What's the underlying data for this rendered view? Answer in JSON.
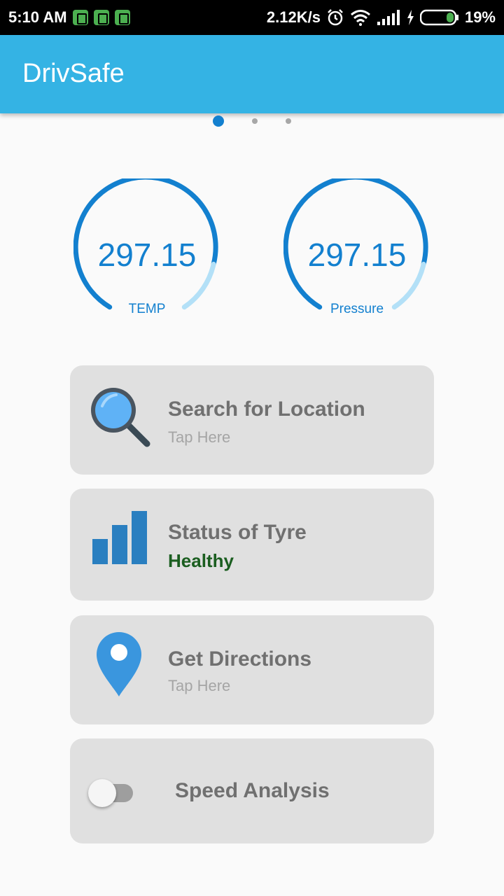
{
  "status_bar": {
    "time": "5:10 AM",
    "network_speed": "2.12K/s",
    "battery": "19%",
    "icons": [
      "notification-icon",
      "alarm-icon",
      "wifi-icon",
      "signal-icon",
      "charging-icon",
      "battery-icon"
    ]
  },
  "app_bar": {
    "title": "DrivSafe"
  },
  "pager": {
    "pages": 3,
    "active": 0
  },
  "gauges": [
    {
      "value": "297.15",
      "label": "TEMP",
      "accent": "#1380cf",
      "track": "#b3e0f7"
    },
    {
      "value": "297.15",
      "label": "Pressure",
      "accent": "#1380cf",
      "track": "#b3e0f7"
    }
  ],
  "cards": {
    "search": {
      "title": "Search for Location",
      "subtitle": "Tap Here",
      "icon": "magnifier-icon"
    },
    "tyre": {
      "title": "Status of Tyre",
      "status": "Healthy",
      "icon": "bar-chart-icon",
      "status_color": "#1b5e20"
    },
    "directions": {
      "title": "Get Directions",
      "subtitle": "Tap Here",
      "icon": "location-pin-icon"
    },
    "speed": {
      "title": "Speed Analysis",
      "toggle_on": false
    }
  },
  "colors": {
    "app_bar": "#34b3e4",
    "card_bg": "#e0e0e0",
    "accent": "#1380cf"
  }
}
